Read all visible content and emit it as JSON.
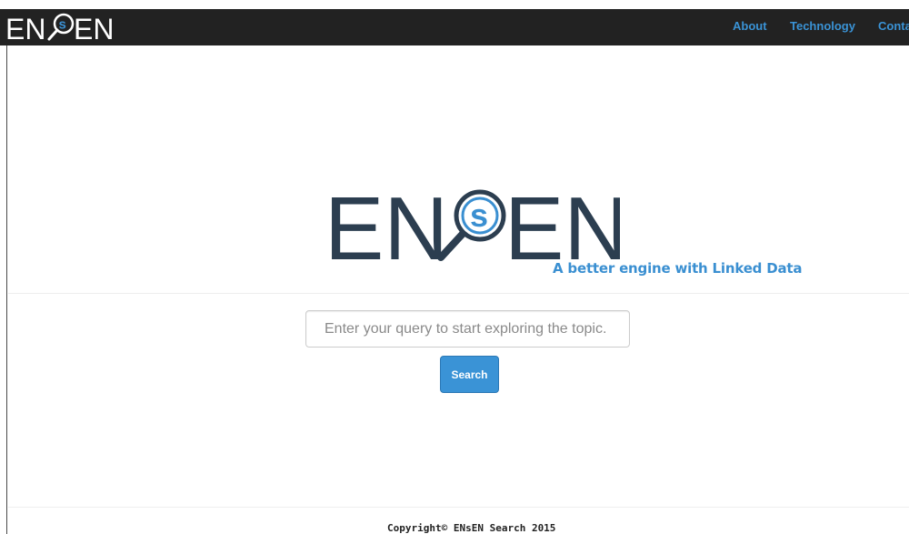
{
  "navbar": {
    "brand": "ENsEN",
    "links": [
      {
        "label": "About"
      },
      {
        "label": "Technology"
      },
      {
        "label": "Conta"
      }
    ]
  },
  "hero": {
    "logo_text": "ENsEN",
    "tagline": "A better engine with Linked Data"
  },
  "search": {
    "placeholder": "Enter your query to start exploring the topic.",
    "value": "",
    "button_label": "Search"
  },
  "footer": {
    "copyright": "Copyright© ENsEN Search 2015"
  },
  "colors": {
    "navbar_bg": "#222222",
    "accent": "#3a93d6",
    "logo_dark": "#2c3e50",
    "logo_blue": "#3a8fd1"
  }
}
